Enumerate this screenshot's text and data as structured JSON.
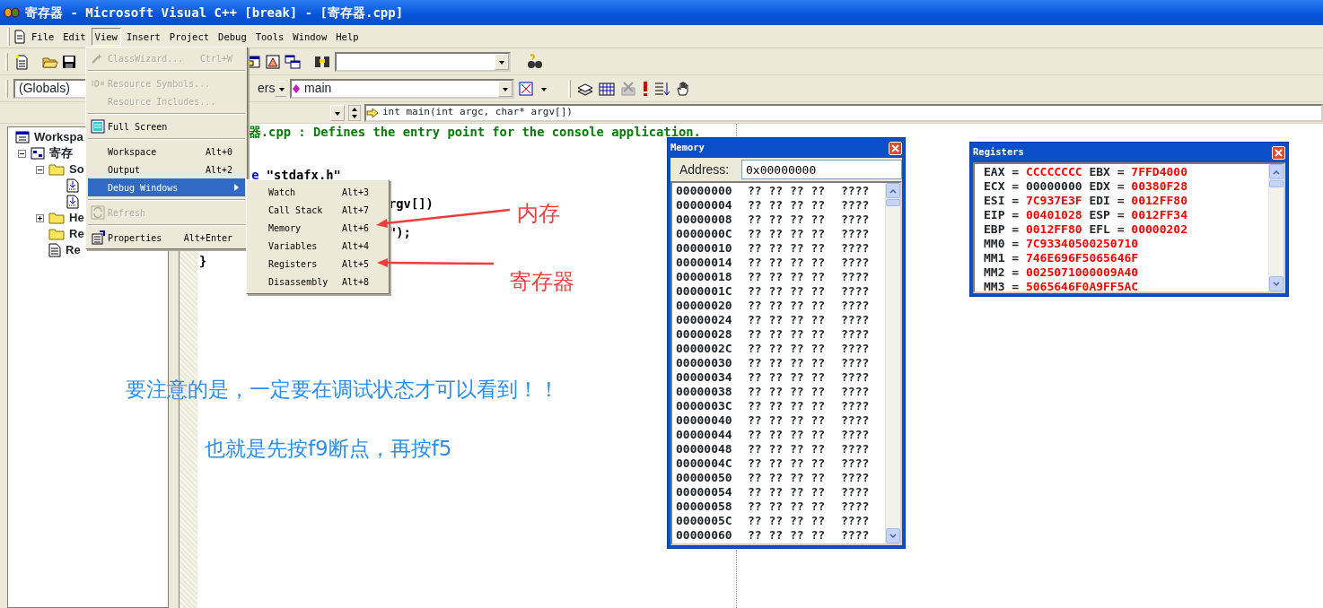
{
  "window": {
    "title": "寄存器 - Microsoft Visual C++ [break] - [寄存器.cpp]"
  },
  "menubar": [
    {
      "label": "File",
      "selected": false
    },
    {
      "label": "Edit",
      "selected": false
    },
    {
      "label": "View",
      "selected": true
    },
    {
      "label": "Insert",
      "selected": false
    },
    {
      "label": "Project",
      "selected": false
    },
    {
      "label": "Debug",
      "selected": false
    },
    {
      "label": "Tools",
      "selected": false
    },
    {
      "label": "Window",
      "selected": false
    },
    {
      "label": "Help",
      "selected": false
    }
  ],
  "context_bar": {
    "scope": "(Globals)",
    "class_fragment": "ers",
    "function": "main",
    "signature": "int main(int argc, char* argv[])"
  },
  "workspace_tree": [
    {
      "label": "Workspa",
      "kind": "workspace",
      "children": [
        {
          "label": "寄存",
          "kind": "project",
          "expanded": true,
          "children": [
            {
              "label": "So",
              "kind": "folder",
              "expanded": true,
              "children": [
                {
                  "kind": "file"
                },
                {
                  "kind": "file"
                }
              ]
            },
            {
              "label": "He",
              "kind": "folder",
              "expanded": false
            },
            {
              "label": "Re",
              "kind": "folder"
            },
            {
              "label": "Re",
              "kind": "document"
            }
          ]
        }
      ]
    }
  ],
  "code_lines": [
    {
      "kind": "text",
      "segments": [
        {
          "kind": "comment",
          "text": "器.cpp : Defines the entry point for the console application."
        }
      ]
    },
    {
      "kind": "blank"
    },
    {
      "kind": "blank"
    },
    {
      "kind": "text",
      "segments": [
        {
          "kind": "keyword",
          "text": "e"
        },
        {
          "kind": "plain",
          "text": " \"stdafx.h\""
        }
      ]
    },
    {
      "kind": "blank"
    },
    {
      "kind": "text",
      "segments": [
        {
          "kind": "plain",
          "text": "rgv[])"
        }
      ]
    },
    {
      "kind": "blank"
    },
    {
      "kind": "text",
      "segments": [
        {
          "kind": "plain",
          "text": "\");"
        }
      ]
    },
    {
      "kind": "blank"
    },
    {
      "kind": "text",
      "segments": [
        {
          "kind": "plain",
          "text": "}"
        }
      ]
    }
  ],
  "view_menu": [
    {
      "kind": "item",
      "label": "ClassWizard...",
      "shortcut": "Ctrl+W",
      "disabled": true,
      "selected": false
    },
    {
      "kind": "separator"
    },
    {
      "kind": "item",
      "label": "Resource Symbols...",
      "disabled": true,
      "selected": false
    },
    {
      "kind": "item",
      "label": "Resource Includes...",
      "disabled": true,
      "selected": false
    },
    {
      "kind": "separator"
    },
    {
      "kind": "item",
      "label": "Full Screen",
      "disabled": false,
      "selected": false
    },
    {
      "kind": "separator"
    },
    {
      "kind": "item",
      "label": "Workspace",
      "shortcut": "Alt+0",
      "disabled": false,
      "selected": false
    },
    {
      "kind": "item",
      "label": "Output",
      "shortcut": "Alt+2",
      "disabled": false,
      "selected": false
    },
    {
      "kind": "submenu",
      "label": "Debug Windows",
      "disabled": false,
      "selected": true
    },
    {
      "kind": "separator"
    },
    {
      "kind": "item",
      "label": "Refresh",
      "disabled": true,
      "selected": false
    },
    {
      "kind": "separator"
    },
    {
      "kind": "item",
      "label": "Properties",
      "shortcut": "Alt+Enter",
      "disabled": false,
      "selected": false
    }
  ],
  "debug_windows_menu": [
    {
      "label": "Watch",
      "shortcut": "Alt+3",
      "selected": false
    },
    {
      "label": "Call Stack",
      "shortcut": "Alt+7",
      "selected": false
    },
    {
      "label": "Memory",
      "shortcut": "Alt+6",
      "selected": false
    },
    {
      "label": "Variables",
      "shortcut": "Alt+4",
      "selected": false
    },
    {
      "label": "Registers",
      "shortcut": "Alt+5",
      "selected": false
    },
    {
      "label": "Disassembly",
      "shortcut": "Alt+8",
      "selected": false
    }
  ],
  "annotations": [
    {
      "kind": "callout",
      "text": "内存"
    },
    {
      "kind": "callout",
      "text": "寄存器"
    },
    {
      "kind": "note",
      "text": "要注意的是，一定要在调试状态才可以看到！！"
    },
    {
      "kind": "note",
      "text": "也就是先按f9断点，再按f5"
    }
  ],
  "memory_window": {
    "title": "Memory",
    "address_label": "Address:",
    "address": "0x00000000",
    "rows": [
      {
        "address": "00000000",
        "bytes": "?? ?? ?? ??",
        "chars": "????"
      },
      {
        "address": "00000004",
        "bytes": "?? ?? ?? ??",
        "chars": "????"
      },
      {
        "address": "00000008",
        "bytes": "?? ?? ?? ??",
        "chars": "????"
      },
      {
        "address": "0000000C",
        "bytes": "?? ?? ?? ??",
        "chars": "????"
      },
      {
        "address": "00000010",
        "bytes": "?? ?? ?? ??",
        "chars": "????"
      },
      {
        "address": "00000014",
        "bytes": "?? ?? ?? ??",
        "chars": "????"
      },
      {
        "address": "00000018",
        "bytes": "?? ?? ?? ??",
        "chars": "????"
      },
      {
        "address": "0000001C",
        "bytes": "?? ?? ?? ??",
        "chars": "????"
      },
      {
        "address": "00000020",
        "bytes": "?? ?? ?? ??",
        "chars": "????"
      },
      {
        "address": "00000024",
        "bytes": "?? ?? ?? ??",
        "chars": "????"
      },
      {
        "address": "00000028",
        "bytes": "?? ?? ?? ??",
        "chars": "????"
      },
      {
        "address": "0000002C",
        "bytes": "?? ?? ?? ??",
        "chars": "????"
      },
      {
        "address": "00000030",
        "bytes": "?? ?? ?? ??",
        "chars": "????"
      },
      {
        "address": "00000034",
        "bytes": "?? ?? ?? ??",
        "chars": "????"
      },
      {
        "address": "00000038",
        "bytes": "?? ?? ?? ??",
        "chars": "????"
      },
      {
        "address": "0000003C",
        "bytes": "?? ?? ?? ??",
        "chars": "????"
      },
      {
        "address": "00000040",
        "bytes": "?? ?? ?? ??",
        "chars": "????"
      },
      {
        "address": "00000044",
        "bytes": "?? ?? ?? ??",
        "chars": "????"
      },
      {
        "address": "00000048",
        "bytes": "?? ?? ?? ??",
        "chars": "????"
      },
      {
        "address": "0000004C",
        "bytes": "?? ?? ?? ??",
        "chars": "????"
      },
      {
        "address": "00000050",
        "bytes": "?? ?? ?? ??",
        "chars": "????"
      },
      {
        "address": "00000054",
        "bytes": "?? ?? ?? ??",
        "chars": "????"
      },
      {
        "address": "00000058",
        "bytes": "?? ?? ?? ??",
        "chars": "????"
      },
      {
        "address": "0000005C",
        "bytes": "?? ?? ?? ??",
        "chars": "????"
      },
      {
        "address": "00000060",
        "bytes": "?? ?? ?? ??",
        "chars": "????"
      }
    ]
  },
  "registers_window": {
    "title": "Registers",
    "rows": [
      [
        {
          "label": "EAX =",
          "value": "CCCCCCCC",
          "changed": true
        },
        {
          "label": "EBX =",
          "value": "7FFD4000",
          "changed": true
        }
      ],
      [
        {
          "label": "ECX =",
          "value": "00000000",
          "changed": false
        },
        {
          "label": "EDX =",
          "value": "00380F28",
          "changed": true
        }
      ],
      [
        {
          "label": "ESI =",
          "value": "7C937E3F",
          "changed": true
        },
        {
          "label": "EDI =",
          "value": "0012FF80",
          "changed": true
        }
      ],
      [
        {
          "label": "EIP =",
          "value": "00401028",
          "changed": true
        },
        {
          "label": "ESP =",
          "value": "0012FF34",
          "changed": true
        }
      ],
      [
        {
          "label": "EBP =",
          "value": "0012FF80",
          "changed": true
        },
        {
          "label": "EFL =",
          "value": "00000202",
          "changed": true
        }
      ],
      [
        {
          "label": "MM0 =",
          "value": "7C93340500250710",
          "changed": true
        }
      ],
      [
        {
          "label": "MM1 =",
          "value": "746E696F5065646F",
          "changed": true
        }
      ],
      [
        {
          "label": "MM2 =",
          "value": "0025071000009A40",
          "changed": true
        }
      ],
      [
        {
          "label": "MM3 =",
          "value": "5065646F0A9FF5AC",
          "changed": true
        }
      ]
    ]
  }
}
